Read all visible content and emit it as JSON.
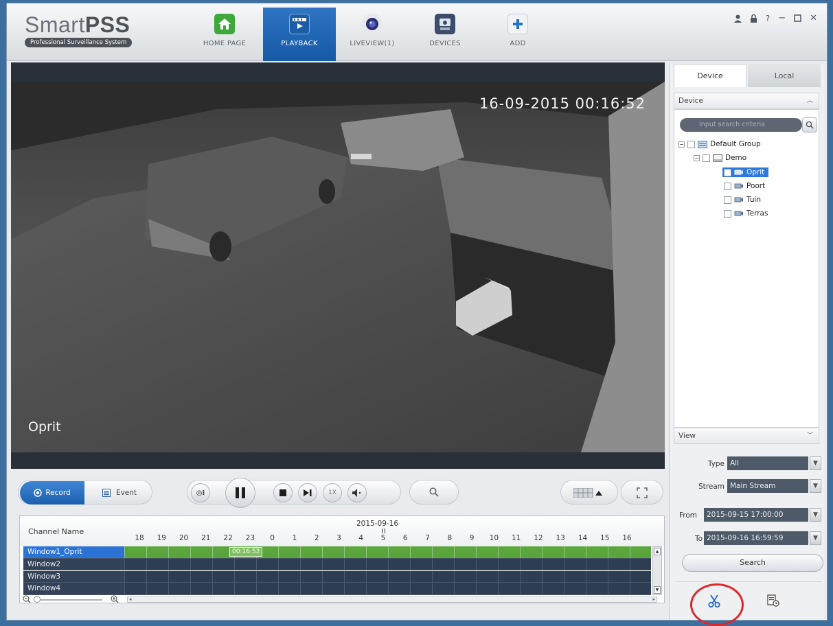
{
  "app": {
    "title_light": "Smart",
    "title_bold": "PSS",
    "subtitle": "Professional Surveillance System"
  },
  "nav": [
    {
      "label": "HOME PAGE",
      "icon": "home-icon",
      "color": "#3fa83a"
    },
    {
      "label": "PLAYBACK",
      "icon": "playback-icon",
      "color": "#2f74c4",
      "active": true
    },
    {
      "label": "LIVEVIEW(1)",
      "icon": "camera-icon",
      "color": "#3c3f8a"
    },
    {
      "label": "DEVICES",
      "icon": "devices-icon",
      "color": "#455a7a"
    },
    {
      "label": "ADD",
      "icon": "add-icon",
      "color": "#1f75c7"
    }
  ],
  "window_controls": [
    "user-icon",
    "lock-icon",
    "help-icon",
    "minimize-icon",
    "maximize-icon",
    "close-icon"
  ],
  "video": {
    "timestamp": "16-09-2015 00:16:52",
    "channel_name": "Oprit"
  },
  "controls": {
    "record_label": "Record",
    "event_label": "Event",
    "speed_label": "1X"
  },
  "timeline": {
    "channel_header": "Channel Name",
    "date": "2015-09-16",
    "hours": [
      "18",
      "19",
      "20",
      "21",
      "22",
      "23",
      "0",
      "1",
      "2",
      "3",
      "4",
      "5",
      "6",
      "7",
      "8",
      "9",
      "10",
      "11",
      "12",
      "13",
      "14",
      "15",
      "16"
    ],
    "rows": [
      {
        "name": "Window1_Oprit",
        "selected": true,
        "has_record": true,
        "marker": "00:16:52"
      },
      {
        "name": "Window2",
        "selected": false,
        "has_record": false
      },
      {
        "name": "Window3",
        "selected": false,
        "has_record": false
      },
      {
        "name": "Window4",
        "selected": false,
        "has_record": false
      }
    ]
  },
  "right_panel": {
    "tabs": [
      "Device",
      "Local"
    ],
    "device_section": "Device",
    "search_placeholder": "Input search criteria",
    "tree": {
      "group": "Default Group",
      "device": "Demo",
      "channels": [
        "Oprit",
        "Poort",
        "Tuin",
        "Terras"
      ],
      "selected_channel": "Oprit"
    },
    "view_section": "View",
    "type_label": "Type",
    "type_value": "All",
    "stream_label": "Stream",
    "stream_value": "Main Stream",
    "from_label": "From",
    "from_value": "2015-09-15 17:00:00",
    "to_label": "To",
    "to_value": "2015-09-16 16:59:59",
    "search_button": "Search"
  },
  "colors": {
    "accent": "#2b74d6",
    "record_track": "#5aa63d",
    "highlight_circle": "#e0252b"
  }
}
